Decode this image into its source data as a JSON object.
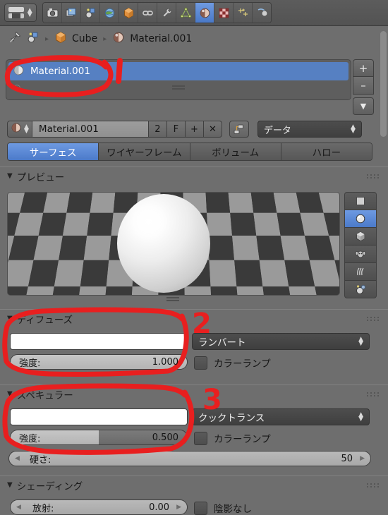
{
  "header": {
    "editor_type_icon": "properties-editor-icon",
    "property_tabs": [
      {
        "name": "render",
        "icon": "camera-icon",
        "active": false
      },
      {
        "name": "render-layers",
        "icon": "images-icon",
        "active": false
      },
      {
        "name": "scene",
        "icon": "scene-icon",
        "active": false
      },
      {
        "name": "world",
        "icon": "globe-icon",
        "active": false
      },
      {
        "name": "object",
        "icon": "cube-icon",
        "active": false
      },
      {
        "name": "constraints",
        "icon": "chain-icon",
        "active": false
      },
      {
        "name": "modifiers",
        "icon": "wrench-icon",
        "active": false
      },
      {
        "name": "object-data",
        "icon": "triangle-mesh-icon",
        "active": false
      },
      {
        "name": "material",
        "icon": "material-sphere-icon",
        "active": true
      },
      {
        "name": "texture",
        "icon": "checker-icon",
        "active": false
      },
      {
        "name": "particles",
        "icon": "particles-icon",
        "active": false
      },
      {
        "name": "physics",
        "icon": "physics-icon",
        "active": false
      }
    ]
  },
  "breadcrumb": {
    "pin_icon": "pin-icon",
    "root_icon": "scene-icon",
    "object_icon": "cube-icon",
    "object_name": "Cube",
    "material_icon": "material-sphere-icon",
    "material_name": "Material.001",
    "separator": "▸"
  },
  "slot_list": {
    "items": [
      {
        "icon": "material-sphere-icon",
        "label": "Material.001",
        "selected": true
      }
    ],
    "add_button": "+",
    "remove_button": "–",
    "menu_button": "▼"
  },
  "material_datablock": {
    "browse_icon": "material-sphere-icon",
    "name": "Material.001",
    "users_count": "2",
    "fake_user": "F",
    "new_button": "+",
    "unlink_button": "✕",
    "node_button_icon": "nodetree-icon",
    "link_mode": "データ"
  },
  "type_tabs": [
    {
      "label": "サーフェス",
      "active": true
    },
    {
      "label": "ワイヤーフレーム",
      "active": false
    },
    {
      "label": "ボリューム",
      "active": false
    },
    {
      "label": "ハロー",
      "active": false
    }
  ],
  "preview_panel": {
    "title": "プレビュー",
    "collapse_arrow": "▼",
    "shape_buttons": [
      {
        "name": "flat-plane",
        "icon": "plane-icon",
        "active": false
      },
      {
        "name": "sphere",
        "icon": "sphere-icon",
        "active": true
      },
      {
        "name": "cube",
        "icon": "cube-icon",
        "active": false
      },
      {
        "name": "monkey",
        "icon": "monkey-icon",
        "active": false
      },
      {
        "name": "hair",
        "icon": "hair-strands-icon",
        "active": false
      },
      {
        "name": "sphere-sky",
        "icon": "sphere-sky-icon",
        "active": false
      }
    ]
  },
  "diffuse_panel": {
    "title": "ディフューズ",
    "collapse_arrow": "▼",
    "color": "#ffffff",
    "shader_model": "ランバート",
    "intensity_label": "強度:",
    "intensity_value": "1.000",
    "intensity_fraction": 1.0,
    "ramp_label": "カラーランプ",
    "ramp_checked": false
  },
  "specular_panel": {
    "title": "スペキュラー",
    "collapse_arrow": "▼",
    "color": "#ffffff",
    "shader_model": "クックトランス",
    "intensity_label": "強度:",
    "intensity_value": "0.500",
    "intensity_fraction": 0.5,
    "ramp_label": "カラーランプ",
    "ramp_checked": false,
    "hardness_label": "硬さ:",
    "hardness_value": "50"
  },
  "shading_panel": {
    "title": "シェーディング",
    "collapse_arrow": "▼",
    "emit_label": "放射:",
    "emit_value": "0.00",
    "shadeless_label": "陰影なし",
    "shadeless_checked": false
  },
  "annotations": {
    "color": "#e81f1f",
    "marks": [
      {
        "label": "1",
        "target": "material-slot-list"
      },
      {
        "label": "2",
        "target": "diffuse-panel"
      },
      {
        "label": "3",
        "target": "specular-panel"
      }
    ]
  }
}
